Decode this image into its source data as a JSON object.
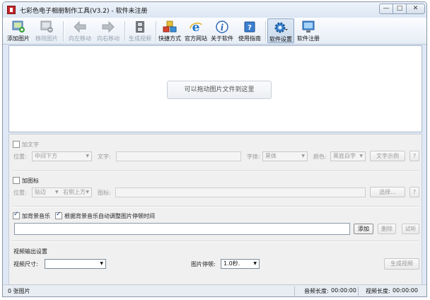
{
  "window": {
    "title": "七彩色电子相册制作工具(V3.2) - 软件未注册",
    "min_label": "—",
    "max_label": "□",
    "close_label": "✕"
  },
  "toolbar": {
    "items": [
      {
        "label": "添加图片",
        "icon": "add-image-icon",
        "enabled": true
      },
      {
        "label": "移除图片",
        "icon": "remove-image-icon",
        "enabled": false
      },
      {
        "label": "向左移动",
        "icon": "arrow-left-icon",
        "enabled": false
      },
      {
        "label": "向右移动",
        "icon": "arrow-right-icon",
        "enabled": false
      },
      {
        "label": "生成视频",
        "icon": "film-icon",
        "enabled": false
      },
      {
        "label": "快捷方式",
        "icon": "shortcut-cubes-icon",
        "enabled": true
      },
      {
        "label": "官方网站",
        "icon": "ie-icon",
        "enabled": true
      },
      {
        "label": "关于软件",
        "icon": "info-icon",
        "enabled": true
      },
      {
        "label": "使用指南",
        "icon": "help-book-icon",
        "enabled": true
      },
      {
        "label": "软件设置",
        "icon": "gear-icon",
        "enabled": true
      },
      {
        "label": "软件注册",
        "icon": "monitor-icon",
        "enabled": true
      }
    ]
  },
  "drop_area": {
    "hint": "可以拖动图片文件到这里"
  },
  "text_section": {
    "checkbox_label": "加文字",
    "checked": false,
    "position_label": "位置:",
    "position_value": "中间下方",
    "text_label": "文字:",
    "font_label": "字体:",
    "font_value": "黑体",
    "color_label": "颜色:",
    "color_value": "黑底白字",
    "sample_button": "文字示例",
    "help_button": "?"
  },
  "icon_section": {
    "checkbox_label": "加图标",
    "checked": false,
    "position_label": "位置:",
    "position_value": "贴边",
    "position_value2": "右侧上方",
    "icon_label": "图标:",
    "choose_button": "选择...",
    "help_button": "?"
  },
  "music_section": {
    "bgm_label": "加背景音乐",
    "bgm_checked": true,
    "auto_label": "根据背景音乐自动调整图片停顿时间",
    "auto_checked": true,
    "add_button": "添加",
    "delete_button": "删除",
    "listen_button": "试听"
  },
  "video_section": {
    "heading": "视频输出设置",
    "size_label": "视频尺寸:",
    "size_value": "",
    "pause_label": "图片停顿:",
    "pause_value": "1.0秒.",
    "generate_button": "生成视频"
  },
  "statusbar": {
    "count": "0 张图片",
    "audio_length_label": "音频长度:",
    "audio_length": "00:00:00",
    "video_length_label": "视频长度:",
    "video_length": "00:00:00"
  }
}
